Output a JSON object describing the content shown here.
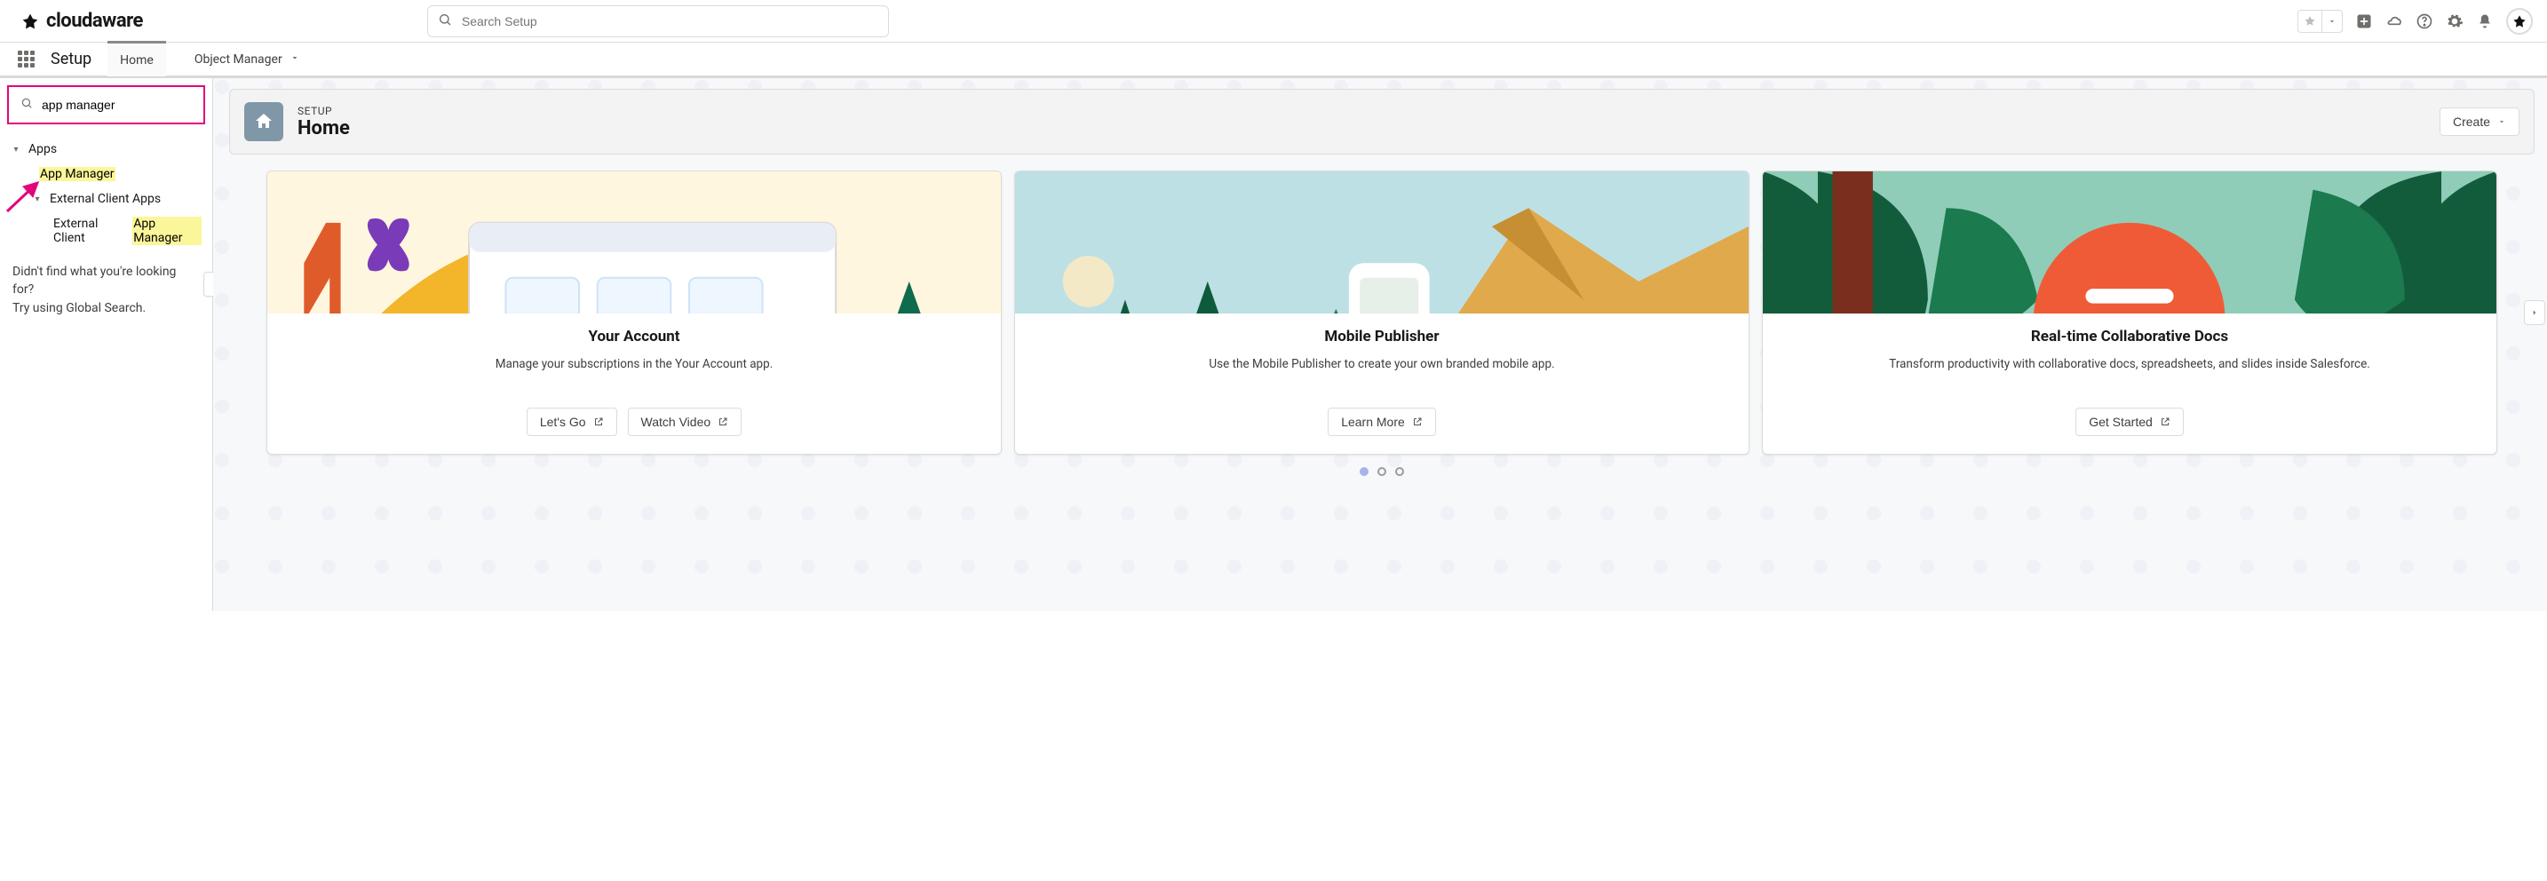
{
  "brand": {
    "name": "cloudaware"
  },
  "global_search": {
    "placeholder": "Search Setup"
  },
  "nav": {
    "app_title": "Setup",
    "tabs": [
      {
        "label": "Home",
        "active": true
      },
      {
        "label": "Object Manager",
        "active": false,
        "has_menu": true
      }
    ]
  },
  "sidebar": {
    "quick_find_value": "app manager",
    "tree": {
      "apps_label": "Apps",
      "app_manager_label": "App Manager",
      "external_client_apps_label": "External Client Apps",
      "external_client_prefix": "External Client ",
      "external_client_hl": "App Manager"
    },
    "not_found_line1": "Didn't find what you're looking for?",
    "not_found_line2": "Try using Global Search."
  },
  "page_header": {
    "kicker": "SETUP",
    "title": "Home",
    "create_label": "Create"
  },
  "cards": [
    {
      "title": "Your Account",
      "desc": "Manage your subscriptions in the Your Account app.",
      "actions": [
        {
          "label": "Let's Go",
          "external": true
        },
        {
          "label": "Watch Video",
          "external": true
        }
      ]
    },
    {
      "title": "Mobile Publisher",
      "desc": "Use the Mobile Publisher to create your own branded mobile app.",
      "actions": [
        {
          "label": "Learn More",
          "external": true
        }
      ]
    },
    {
      "title": "Real-time Collaborative Docs",
      "desc": "Transform productivity with collaborative docs, spreadsheets, and slides inside Salesforce.",
      "actions": [
        {
          "label": "Get Started",
          "external": true
        }
      ]
    }
  ],
  "carousel": {
    "active_index": 0,
    "count": 3
  }
}
